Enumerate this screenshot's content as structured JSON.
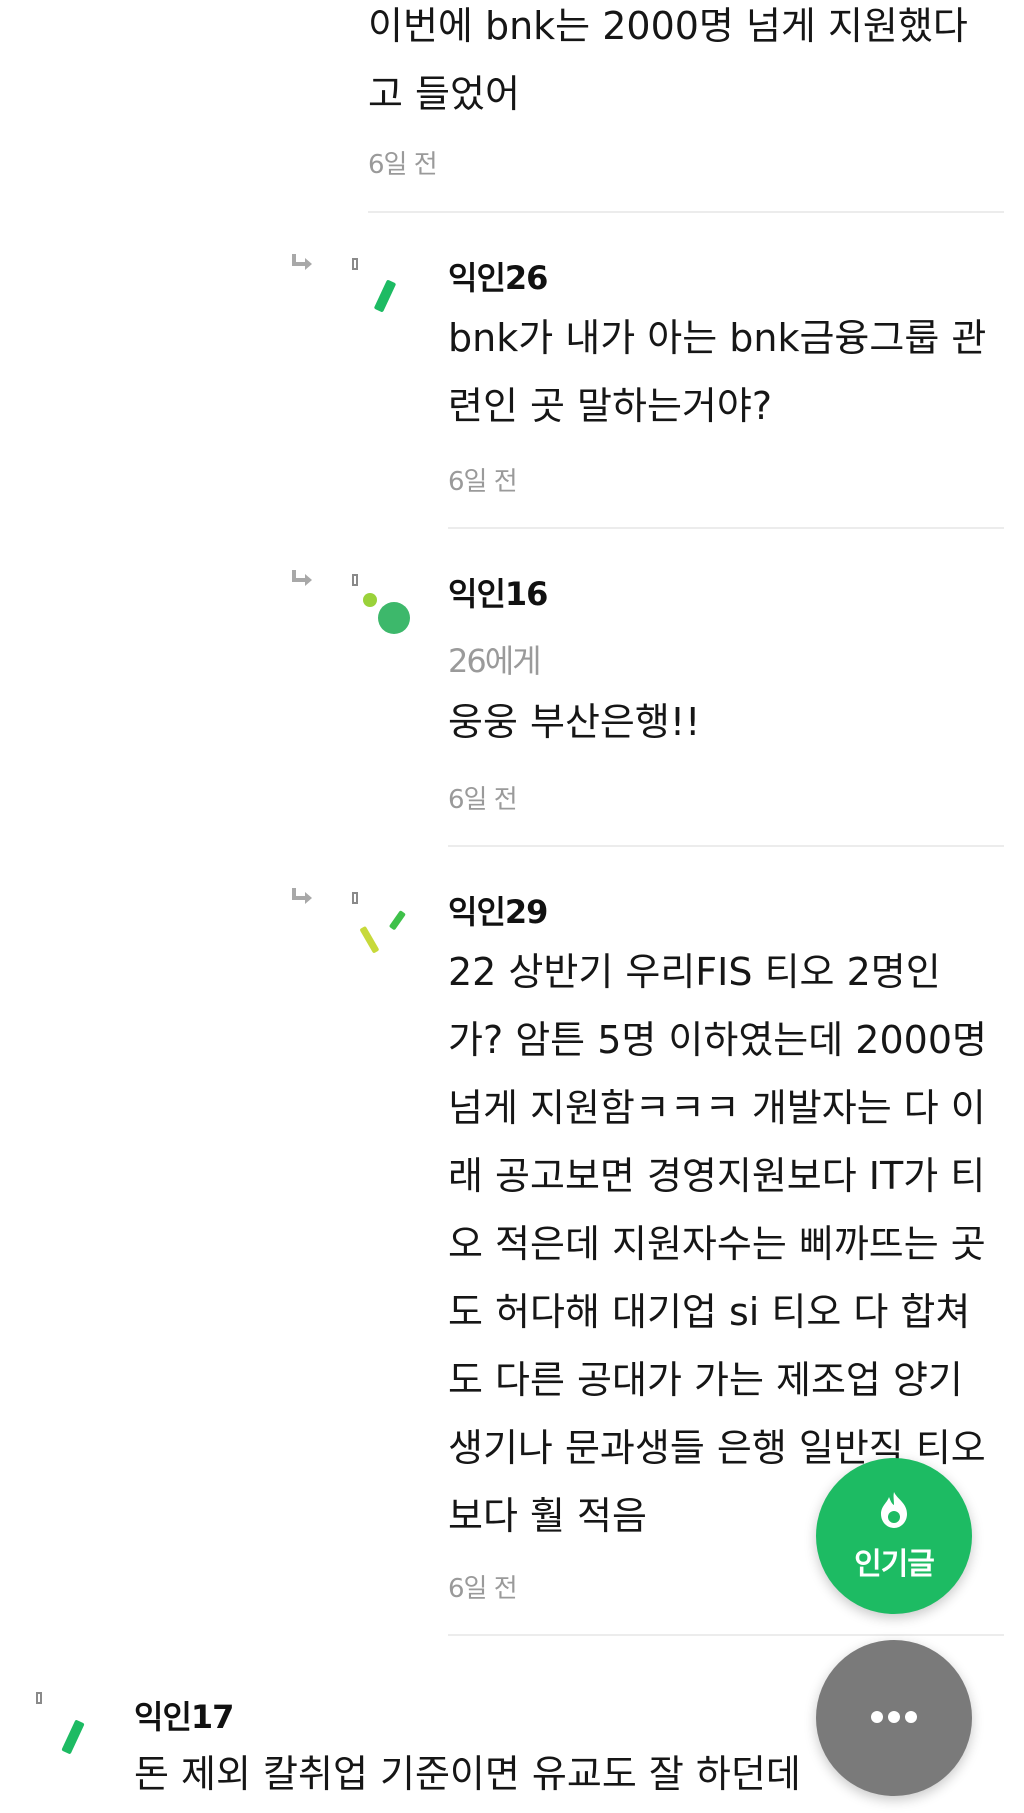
{
  "top_comment": {
    "body": "이번에 bnk는 2000명 넘게 지원했다\n고 들었어",
    "time": "6일 전"
  },
  "replies": [
    {
      "author": "익인26",
      "body": "bnk가 내가 아는 bnk금융그룹 관\n련인 곳 말하는거야?",
      "time": "6일 전"
    },
    {
      "author": "익인16",
      "target": "26에게",
      "body": "웅웅 부산은행!!",
      "time": "6일 전"
    },
    {
      "author": "익인29",
      "body": "22 상반기 우리FIS 티오 2명인\n가? 암튼 5명 이하였는데 2000명\n넘게 지원함ㅋㅋㅋ 개발자는 다 이\n래 공고보면 경영지원보다 IT가 티\n오 적은데 지원자수는 삐까뜨는 곳\n도 허다해 대기업 si 티오 다 합쳐\n도 다른 공대가 가는 제조업 양기\n생기나 문과생들 은행 일반직 티오\n보다 훨 적음",
      "time": "6일 전"
    }
  ],
  "bottom_comment": {
    "author": "익인17",
    "body": "돈 제외 칼취업 기준이면 유교도 잘 하던데"
  },
  "buttons": {
    "popular_label": "인기글",
    "more_icon": "more-dots-icon"
  },
  "colors": {
    "accent_green": "#1dbb63",
    "more_gray": "#7a7a7a",
    "time_gray": "#9a9a9a"
  }
}
